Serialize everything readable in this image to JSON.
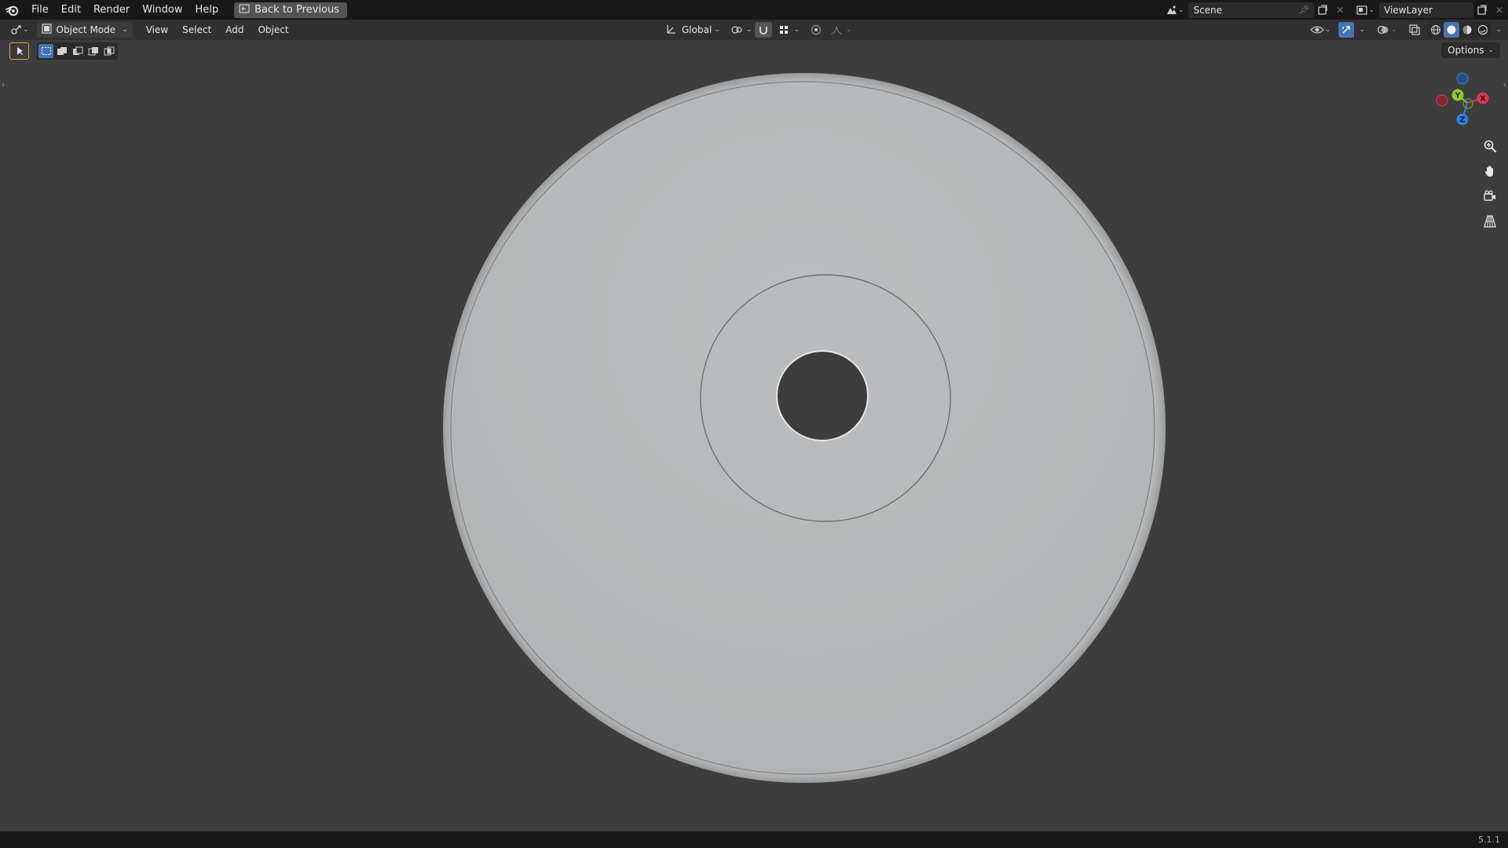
{
  "topbar": {
    "menus": [
      "File",
      "Edit",
      "Render",
      "Window",
      "Help"
    ],
    "back_label": "Back to Previous",
    "scene": "Scene",
    "view_layer": "ViewLayer"
  },
  "header": {
    "mode": "Object Mode",
    "menus": [
      "View",
      "Select",
      "Add",
      "Object"
    ],
    "orientation": "Global",
    "options_label": "Options"
  },
  "gizmo": {
    "x_label": "X",
    "y_label": "Y",
    "z_label": "Z",
    "x_color": "#e1364f",
    "y_color": "#8fcb2b",
    "z_color": "#2f80e0"
  },
  "colors": {
    "accent": "#4772b3",
    "viewport_bg": "#3d3d3d",
    "disc": "#b6b8b9"
  },
  "icons": [
    "blender-logo-icon",
    "back-icon",
    "scene-icon",
    "pin-icon",
    "new-scene-icon",
    "close-icon",
    "view-layer-icon",
    "editor-type-icon",
    "object-mode-icon",
    "transform-orientation-icon",
    "pivot-icon",
    "snap-icon",
    "snap-increment-icon",
    "proportional-edit-icon",
    "falloff-icon",
    "visibility-icon",
    "gizmo-icon",
    "overlay-icon",
    "xray-icon",
    "wireframe-shading-icon",
    "solid-shading-icon",
    "material-shading-icon",
    "rendered-shading-icon",
    "select-tool-icon",
    "zoom-icon",
    "pan-hand-icon",
    "camera-view-icon",
    "perspective-grid-icon"
  ],
  "status": {
    "version": "5.1.1"
  }
}
